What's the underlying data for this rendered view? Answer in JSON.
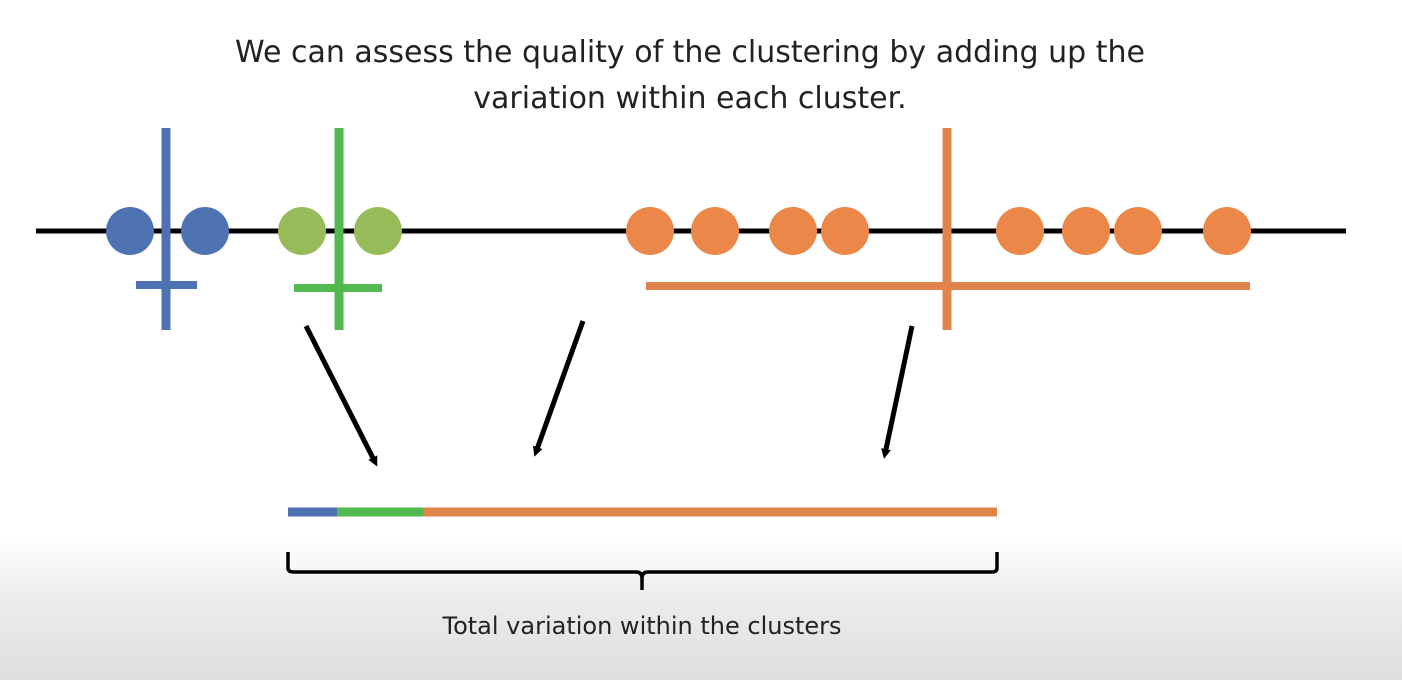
{
  "title": {
    "line1": "We can assess the quality of the clustering by adding up the",
    "line2": "variation within each cluster."
  },
  "caption": "Total variation within the clusters",
  "colors": {
    "blue": "#4f72b3",
    "green": "#51b94f",
    "green_point": "#98bb59",
    "orange": "#e0844c",
    "point_orange": "#ea8749",
    "axis": "#000000"
  },
  "clusters": [
    {
      "name": "blue",
      "points": [
        1,
        2
      ],
      "mean": 1.5,
      "variation_share": 0.07
    },
    {
      "name": "green",
      "points": [
        3,
        4
      ],
      "mean": 3.5,
      "variation_share": 0.12
    },
    {
      "name": "orange",
      "points": [
        5,
        6,
        7,
        8,
        9,
        10,
        11,
        12
      ],
      "mean": 8.5,
      "variation_share": 0.81
    }
  ]
}
